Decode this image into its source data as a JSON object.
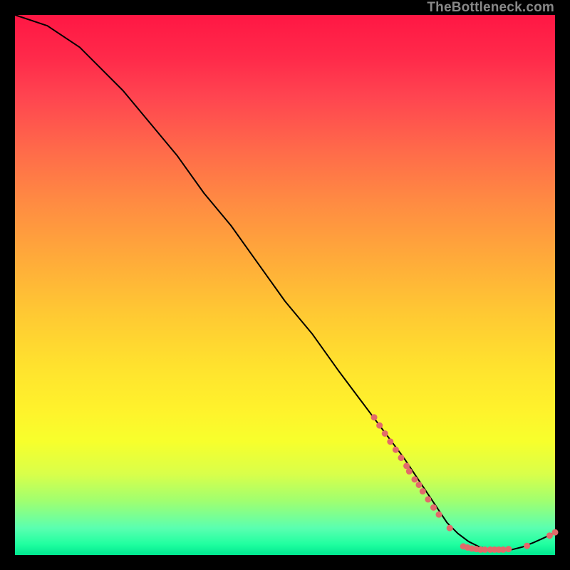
{
  "watermark": "TheBottleneck.com",
  "chart_data": {
    "type": "line",
    "title": "",
    "xlabel": "",
    "ylabel": "",
    "xlim": [
      0,
      100
    ],
    "ylim": [
      0,
      100
    ],
    "grid": false,
    "legend": false,
    "series": [
      {
        "name": "bottleneck-curve",
        "color": "#000000",
        "x": [
          0,
          3,
          6,
          9,
          12,
          15,
          20,
          25,
          30,
          35,
          40,
          45,
          50,
          55,
          60,
          63,
          66,
          69,
          72,
          74,
          76,
          78,
          80,
          82,
          84,
          86,
          88,
          90,
          92,
          94,
          96,
          98,
          100
        ],
        "y": [
          100,
          99,
          98,
          96,
          94,
          91,
          86,
          80,
          74,
          67,
          61,
          54,
          47,
          41,
          34,
          30,
          26,
          22,
          18,
          15,
          12,
          9,
          6,
          4,
          2.5,
          1.5,
          1,
          1,
          1,
          1.5,
          2.3,
          3.2,
          4.2
        ]
      }
    ],
    "markers": [
      {
        "name": "cluster-on-curve",
        "color": "#e26a6a",
        "radius": 4.5,
        "points": [
          {
            "x": 66.5,
            "y": 25.5
          },
          {
            "x": 67.5,
            "y": 24
          },
          {
            "x": 68.5,
            "y": 22.5
          },
          {
            "x": 69.5,
            "y": 21
          },
          {
            "x": 70.5,
            "y": 19.5
          },
          {
            "x": 71.5,
            "y": 18
          },
          {
            "x": 72.5,
            "y": 16.5
          },
          {
            "x": 73.0,
            "y": 15.5
          },
          {
            "x": 74.0,
            "y": 14
          },
          {
            "x": 74.8,
            "y": 13
          },
          {
            "x": 75.5,
            "y": 11.8
          },
          {
            "x": 76.5,
            "y": 10.3
          },
          {
            "x": 77.5,
            "y": 8.8
          },
          {
            "x": 78.5,
            "y": 7.5
          },
          {
            "x": 80.5,
            "y": 5
          },
          {
            "x": 83.0,
            "y": 1.6
          },
          {
            "x": 83.8,
            "y": 1.4
          },
          {
            "x": 84.6,
            "y": 1.2
          },
          {
            "x": 85.4,
            "y": 1.1
          },
          {
            "x": 86.2,
            "y": 1.0
          },
          {
            "x": 87.0,
            "y": 1.0
          },
          {
            "x": 88.0,
            "y": 1.0
          },
          {
            "x": 88.8,
            "y": 1.0
          },
          {
            "x": 89.6,
            "y": 1.0
          },
          {
            "x": 90.4,
            "y": 1.0
          },
          {
            "x": 91.4,
            "y": 1.1
          },
          {
            "x": 94.8,
            "y": 1.7
          },
          {
            "x": 99.0,
            "y": 3.6
          },
          {
            "x": 100.0,
            "y": 4.2
          }
        ]
      }
    ]
  }
}
